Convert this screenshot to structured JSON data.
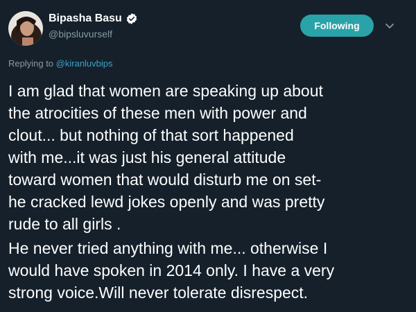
{
  "author": {
    "display_name": "Bipasha Basu",
    "handle": "@bipsluvurself",
    "verified": true,
    "avatar": "profile-photo"
  },
  "follow_button": {
    "label": "Following",
    "color": "#2aa3a8"
  },
  "menu": {
    "icon": "chevron-down-icon"
  },
  "reply": {
    "prefix": "Replying to",
    "target": "@kiranluvbips"
  },
  "tweet": {
    "paragraph_1": "I am glad that women are speaking up about\nthe atrocities of these men with power and\nclout... but nothing of that sort happened\nwith me...it was just his general attitude\ntoward women that would disturb me on set-\nhe cracked lewd jokes openly and was pretty\nrude to all girls .",
    "paragraph_2": "He never tried anything with me... otherwise I\nwould have spoken in 2014 only. I have a very\nstrong voice.Will never tolerate disrespect."
  },
  "colors": {
    "background": "#15202b",
    "secondary_text": "#8899a6",
    "link": "#3aa3c8"
  }
}
